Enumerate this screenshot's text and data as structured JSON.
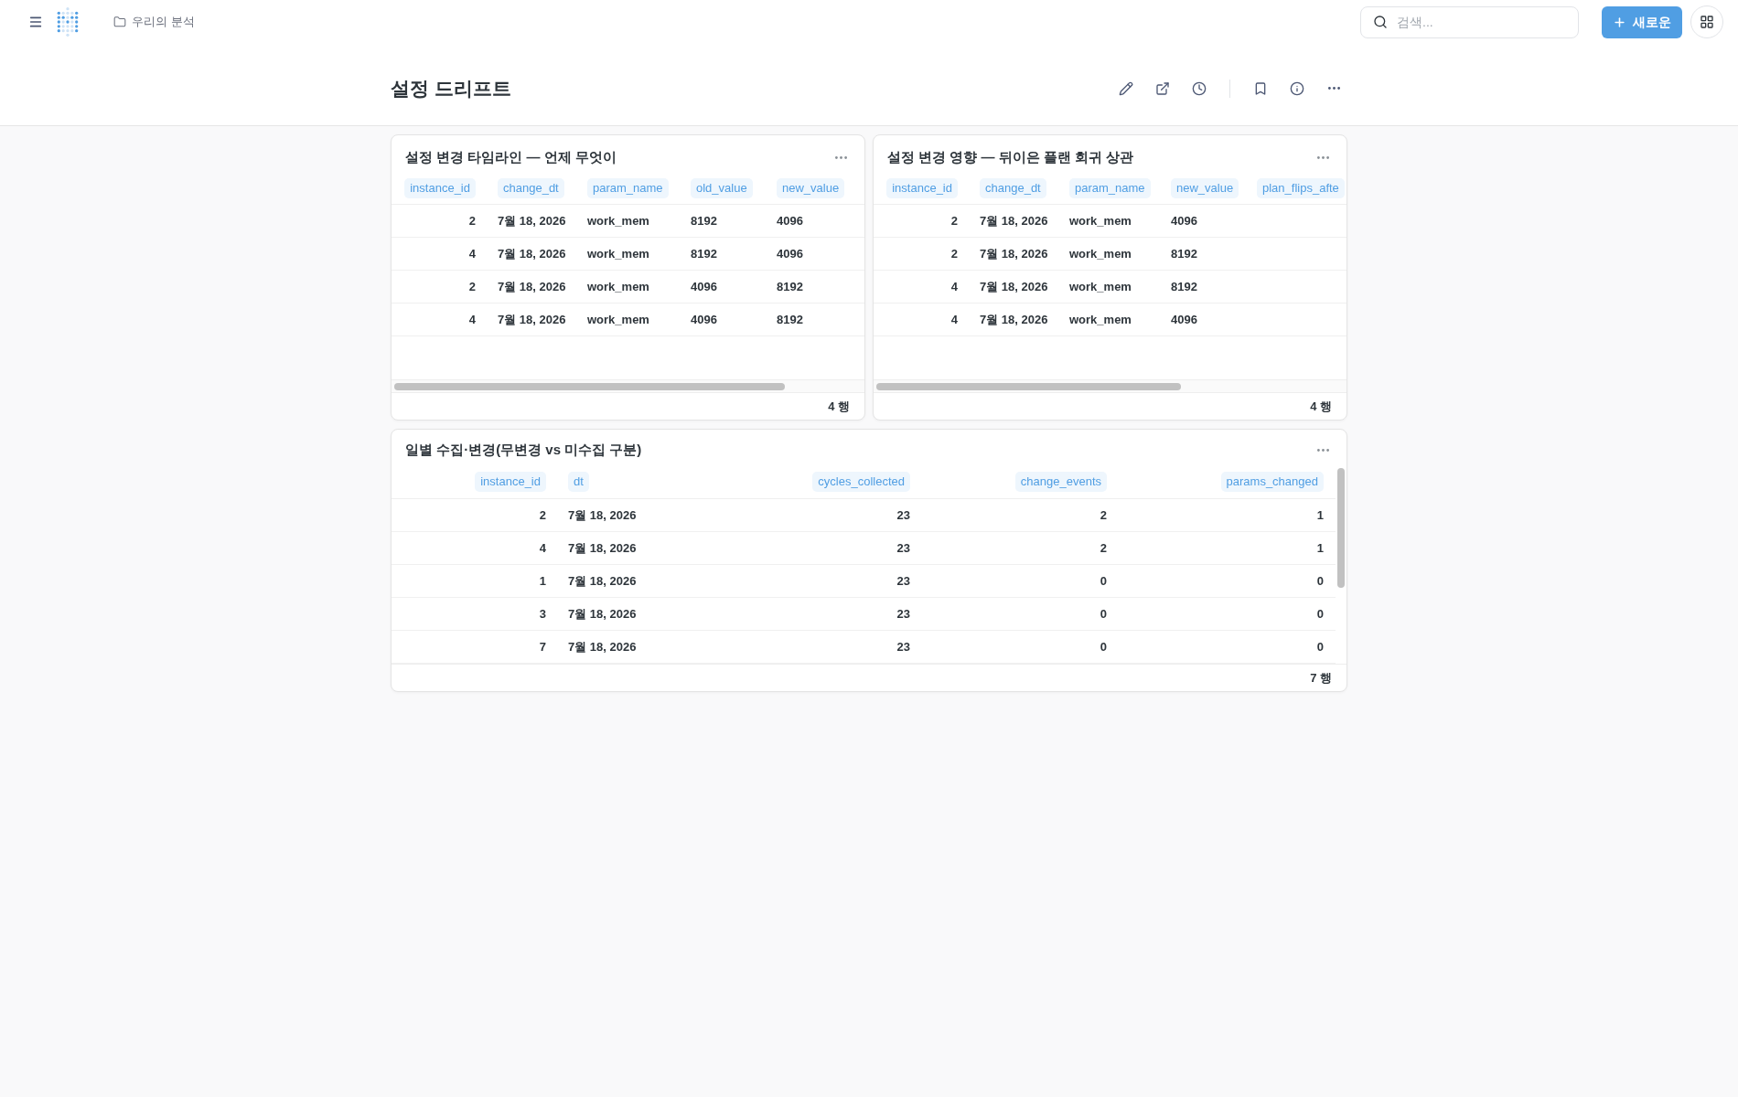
{
  "top_bar": {
    "breadcrumb": "우리의 분석",
    "search": {
      "placeholder": "검색..."
    },
    "new_button": "새로운"
  },
  "page_title": "설정 드리프트",
  "cards": [
    {
      "title": "설정 변경 타임라인 — 언제 무엇이",
      "columns": [
        {
          "label": "instance_id",
          "kind": "numeric"
        },
        {
          "label": "change_dt",
          "kind": "text"
        },
        {
          "label": "param_name",
          "kind": "text"
        },
        {
          "label": "old_value",
          "kind": "text"
        },
        {
          "label": "new_value",
          "kind": "text"
        }
      ],
      "rows": [
        [
          "2",
          "7월 18, 2026",
          "work_mem",
          "8192",
          "4096"
        ],
        [
          "4",
          "7월 18, 2026",
          "work_mem",
          "8192",
          "4096"
        ],
        [
          "2",
          "7월 18, 2026",
          "work_mem",
          "4096",
          "8192"
        ],
        [
          "4",
          "7월 18, 2026",
          "work_mem",
          "4096",
          "8192"
        ]
      ],
      "row_count": "4 행"
    },
    {
      "title": "설정 변경 영향 — 뒤이은 플랜 회귀 상관",
      "columns": [
        {
          "label": "instance_id",
          "kind": "numeric"
        },
        {
          "label": "change_dt",
          "kind": "text"
        },
        {
          "label": "param_name",
          "kind": "text"
        },
        {
          "label": "new_value",
          "kind": "text"
        },
        {
          "label": "plan_flips_afte",
          "kind": "text"
        }
      ],
      "rows": [
        [
          "2",
          "7월 18, 2026",
          "work_mem",
          "4096"
        ],
        [
          "2",
          "7월 18, 2026",
          "work_mem",
          "8192"
        ],
        [
          "4",
          "7월 18, 2026",
          "work_mem",
          "8192"
        ],
        [
          "4",
          "7월 18, 2026",
          "work_mem",
          "4096"
        ]
      ],
      "row_count": "4 행"
    },
    {
      "title": "일별 수집·변경(무변경 vs 미수집 구분)",
      "columns": [
        {
          "label": "instance_id",
          "kind": "numeric"
        },
        {
          "label": "dt",
          "kind": "text"
        },
        {
          "label": "cycles_collected",
          "kind": "numeric"
        },
        {
          "label": "change_events",
          "kind": "numeric"
        },
        {
          "label": "params_changed",
          "kind": "numeric"
        }
      ],
      "rows": [
        [
          "2",
          "7월 18, 2026",
          "23",
          "2",
          "1"
        ],
        [
          "4",
          "7월 18, 2026",
          "23",
          "2",
          "1"
        ],
        [
          "1",
          "7월 18, 2026",
          "23",
          "0",
          "0"
        ],
        [
          "3",
          "7월 18, 2026",
          "23",
          "0",
          "0"
        ],
        [
          "7",
          "7월 18, 2026",
          "23",
          "0",
          "0"
        ]
      ],
      "row_count": "7 행"
    }
  ]
}
